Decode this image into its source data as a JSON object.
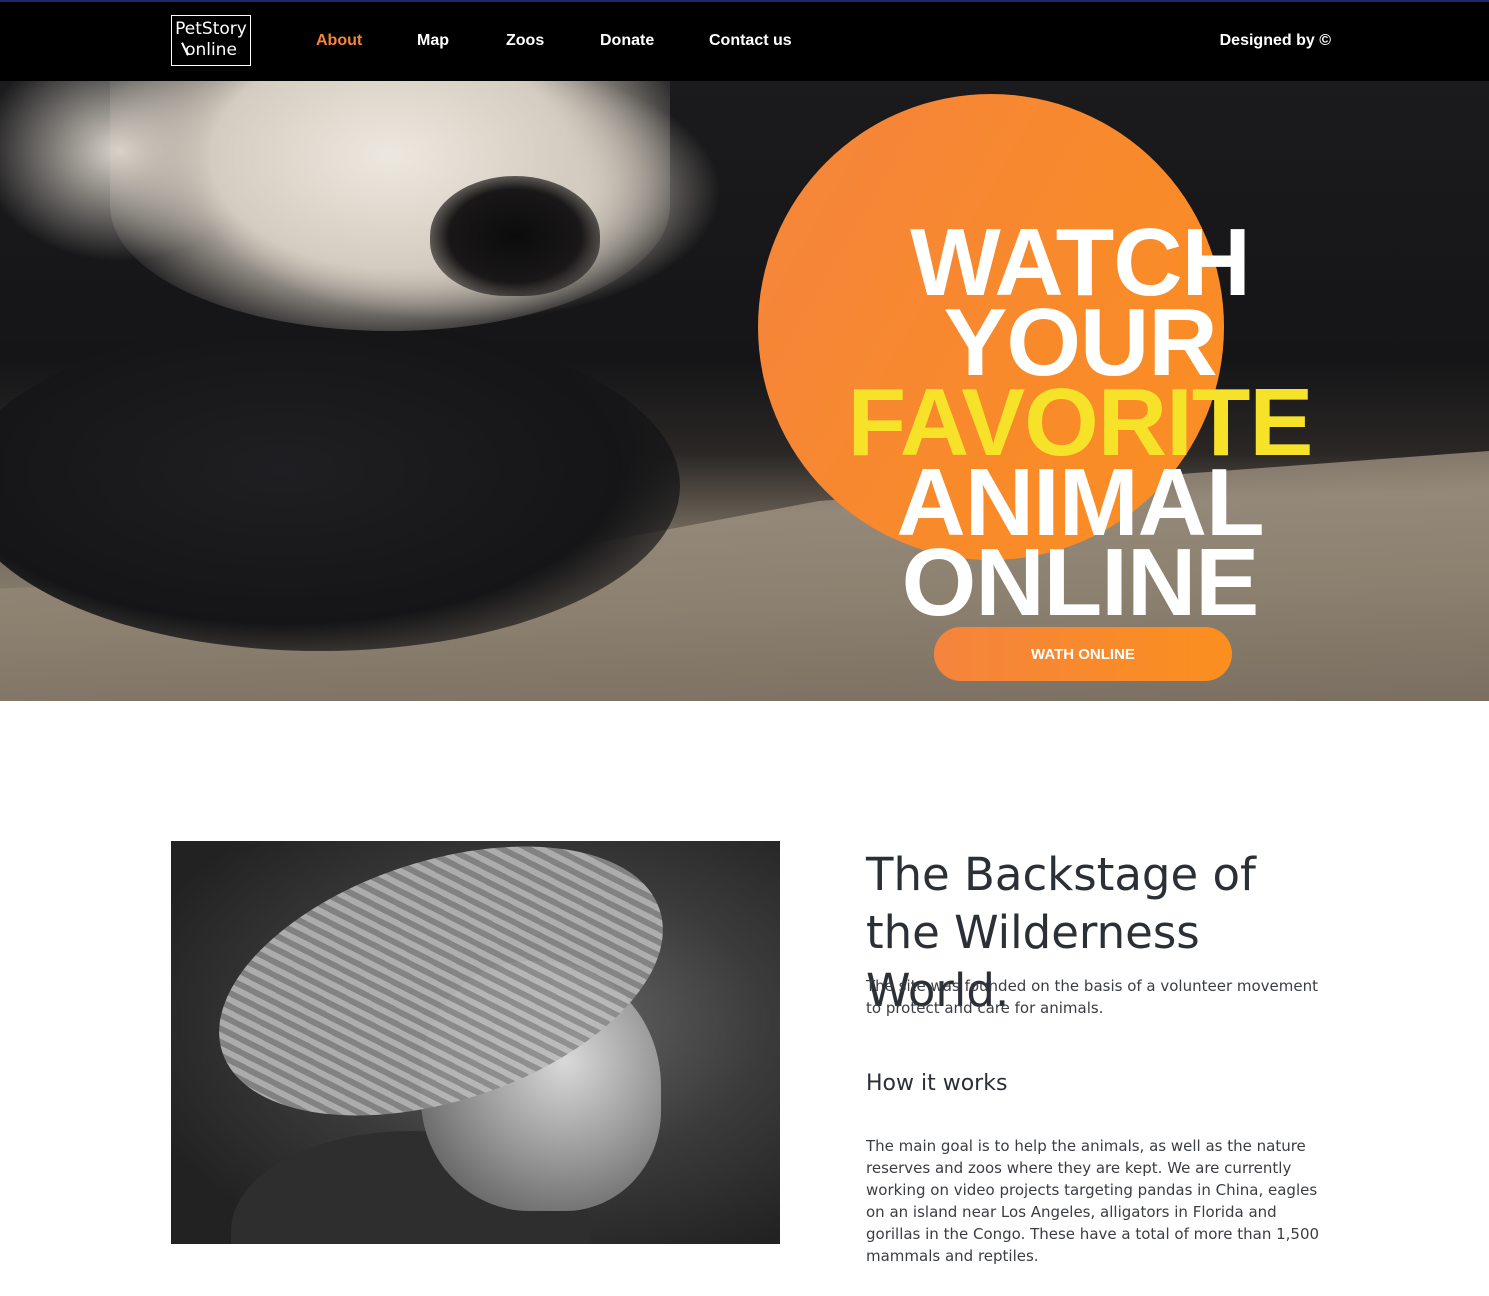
{
  "header": {
    "logo_line1": "PetStory",
    "logo_line2": "online",
    "nav": [
      {
        "label": "About",
        "active": true
      },
      {
        "label": "Map",
        "active": false
      },
      {
        "label": "Zoos",
        "active": false
      },
      {
        "label": "Donate",
        "active": false
      },
      {
        "label": "Contact us",
        "active": false
      }
    ],
    "designed_by": "Designed by ©"
  },
  "hero": {
    "title_lines": [
      "WATCH",
      "YOUR",
      "FAVORITE",
      "ANIMAL",
      "ONLINE"
    ],
    "cta_label": "WATH ONLINE"
  },
  "about": {
    "title": "The Backstage of the Wilderness World.",
    "intro": "The site was founded on the basis of a volunteer movement to protect and care for animals.",
    "how_title": "How it works",
    "how_text": "The main goal is to help the animals, as well as the nature reserves and zoos where they are kept. We are currently working on video projects targeting pandas in China, eagles on an island near Los Angeles, alligators in Florida and gorillas in the Congo. These have a total of more than 1,500 mammals and reptiles."
  },
  "colors": {
    "accent": "#f5843d",
    "highlight": "#f7e22a",
    "nav_bg": "#000000",
    "text_dark": "#2b2f36"
  }
}
